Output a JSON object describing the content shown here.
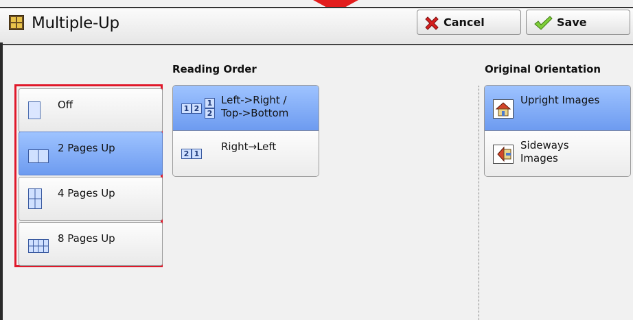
{
  "header": {
    "title": "Multiple-Up",
    "cancel_label": "Cancel",
    "save_label": "Save"
  },
  "layout_options": {
    "items": [
      {
        "label": "Off",
        "icon": "single-page-icon",
        "selected": false
      },
      {
        "label": "2 Pages Up",
        "icon": "two-pages-icon",
        "selected": true
      },
      {
        "label": "4 Pages Up",
        "icon": "four-pages-icon",
        "selected": false
      },
      {
        "label": "8 Pages Up",
        "icon": "eight-pages-icon",
        "selected": false
      }
    ]
  },
  "reading_order": {
    "heading": "Reading Order",
    "options": [
      {
        "line1": "Left->Right /",
        "line2": "Top->Bottom",
        "selected": true
      },
      {
        "line1": "Right→Left",
        "line2": "",
        "selected": false
      }
    ],
    "numbers": {
      "one": "1",
      "two": "2"
    }
  },
  "original_orientation": {
    "heading": "Original Orientation",
    "options": [
      {
        "line1": "Upright Images",
        "line2": "",
        "icon": "upright-image-icon",
        "selected": true
      },
      {
        "line1": "Sideways",
        "line2": "Images",
        "icon": "sideways-image-icon",
        "selected": false
      }
    ]
  },
  "colors": {
    "selected": "#7fa8f5",
    "highlight_border": "#e0182a",
    "pointer": "#e21d1d"
  }
}
